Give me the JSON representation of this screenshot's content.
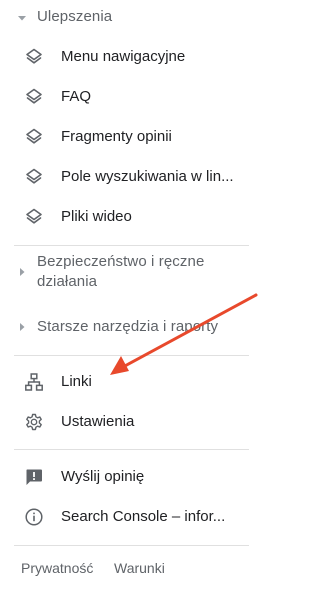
{
  "sidebar": {
    "enhancements": {
      "label": "Ulepszenia",
      "expanded": true,
      "items": [
        {
          "label": "Menu nawigacyjne",
          "icon": "layers-icon"
        },
        {
          "label": "FAQ",
          "icon": "layers-icon"
        },
        {
          "label": "Fragmenty opinii",
          "icon": "layers-icon"
        },
        {
          "label": "Pole wyszukiwania w lin...",
          "icon": "layers-icon"
        },
        {
          "label": "Pliki wideo",
          "icon": "layers-icon"
        }
      ]
    },
    "security": {
      "label_line1": "Bezpieczeństwo i ręczne",
      "label_line2": "działania",
      "expanded": false
    },
    "legacy": {
      "label": "Starsze narzędzia i raporty",
      "expanded": false
    },
    "main_items": [
      {
        "label": "Linki",
        "icon": "sitemap-icon"
      },
      {
        "label": "Ustawienia",
        "icon": "gear-icon"
      }
    ],
    "bottom_items": [
      {
        "label": "Wyślij opinię",
        "icon": "feedback-icon"
      },
      {
        "label": "Search Console – infor...",
        "icon": "info-icon"
      }
    ],
    "footer": {
      "privacy": "Prywatność",
      "terms": "Warunki"
    }
  },
  "annotation": {
    "arrow_color": "#e8492c"
  }
}
